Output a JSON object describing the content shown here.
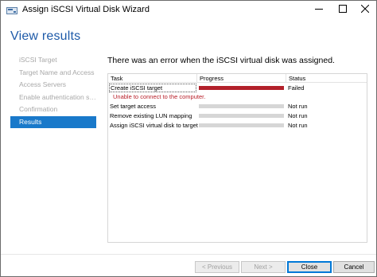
{
  "window": {
    "title": "Assign iSCSI Virtual Disk Wizard"
  },
  "page": {
    "title": "View results"
  },
  "nav": {
    "items": [
      {
        "label": "iSCSI Target"
      },
      {
        "label": "Target Name and Access"
      },
      {
        "label": "Access Servers"
      },
      {
        "label": "Enable authentication ser..."
      },
      {
        "label": "Confirmation"
      },
      {
        "label": "Results"
      }
    ]
  },
  "main": {
    "heading": "There was an error when the iSCSI virtual disk was assigned.",
    "columns": {
      "task": "Task",
      "progress": "Progress",
      "status": "Status"
    },
    "error_message": "Unable to connect to the computer.",
    "rows": [
      {
        "task": "Create iSCSI target",
        "progress": 1.0,
        "status": "Failed"
      },
      {
        "task": "Set target access",
        "progress": 0,
        "status": "Not run"
      },
      {
        "task": "Remove existing LUN mapping",
        "progress": 0,
        "status": "Not run"
      },
      {
        "task": "Assign iSCSI virtual disk to target",
        "progress": 0,
        "status": "Not run"
      }
    ]
  },
  "buttons": {
    "previous": "< Previous",
    "next": "Next >",
    "close": "Close",
    "cancel": "Cancel"
  },
  "colors": {
    "accent": "#1979ca",
    "title": "#1e5aa8",
    "error": "#b2202a",
    "error_text": "#b8202a"
  },
  "icons": {
    "app": "disk-wizard-icon",
    "minimize": "minimize-icon",
    "maximize": "maximize-icon",
    "close": "close-icon"
  }
}
